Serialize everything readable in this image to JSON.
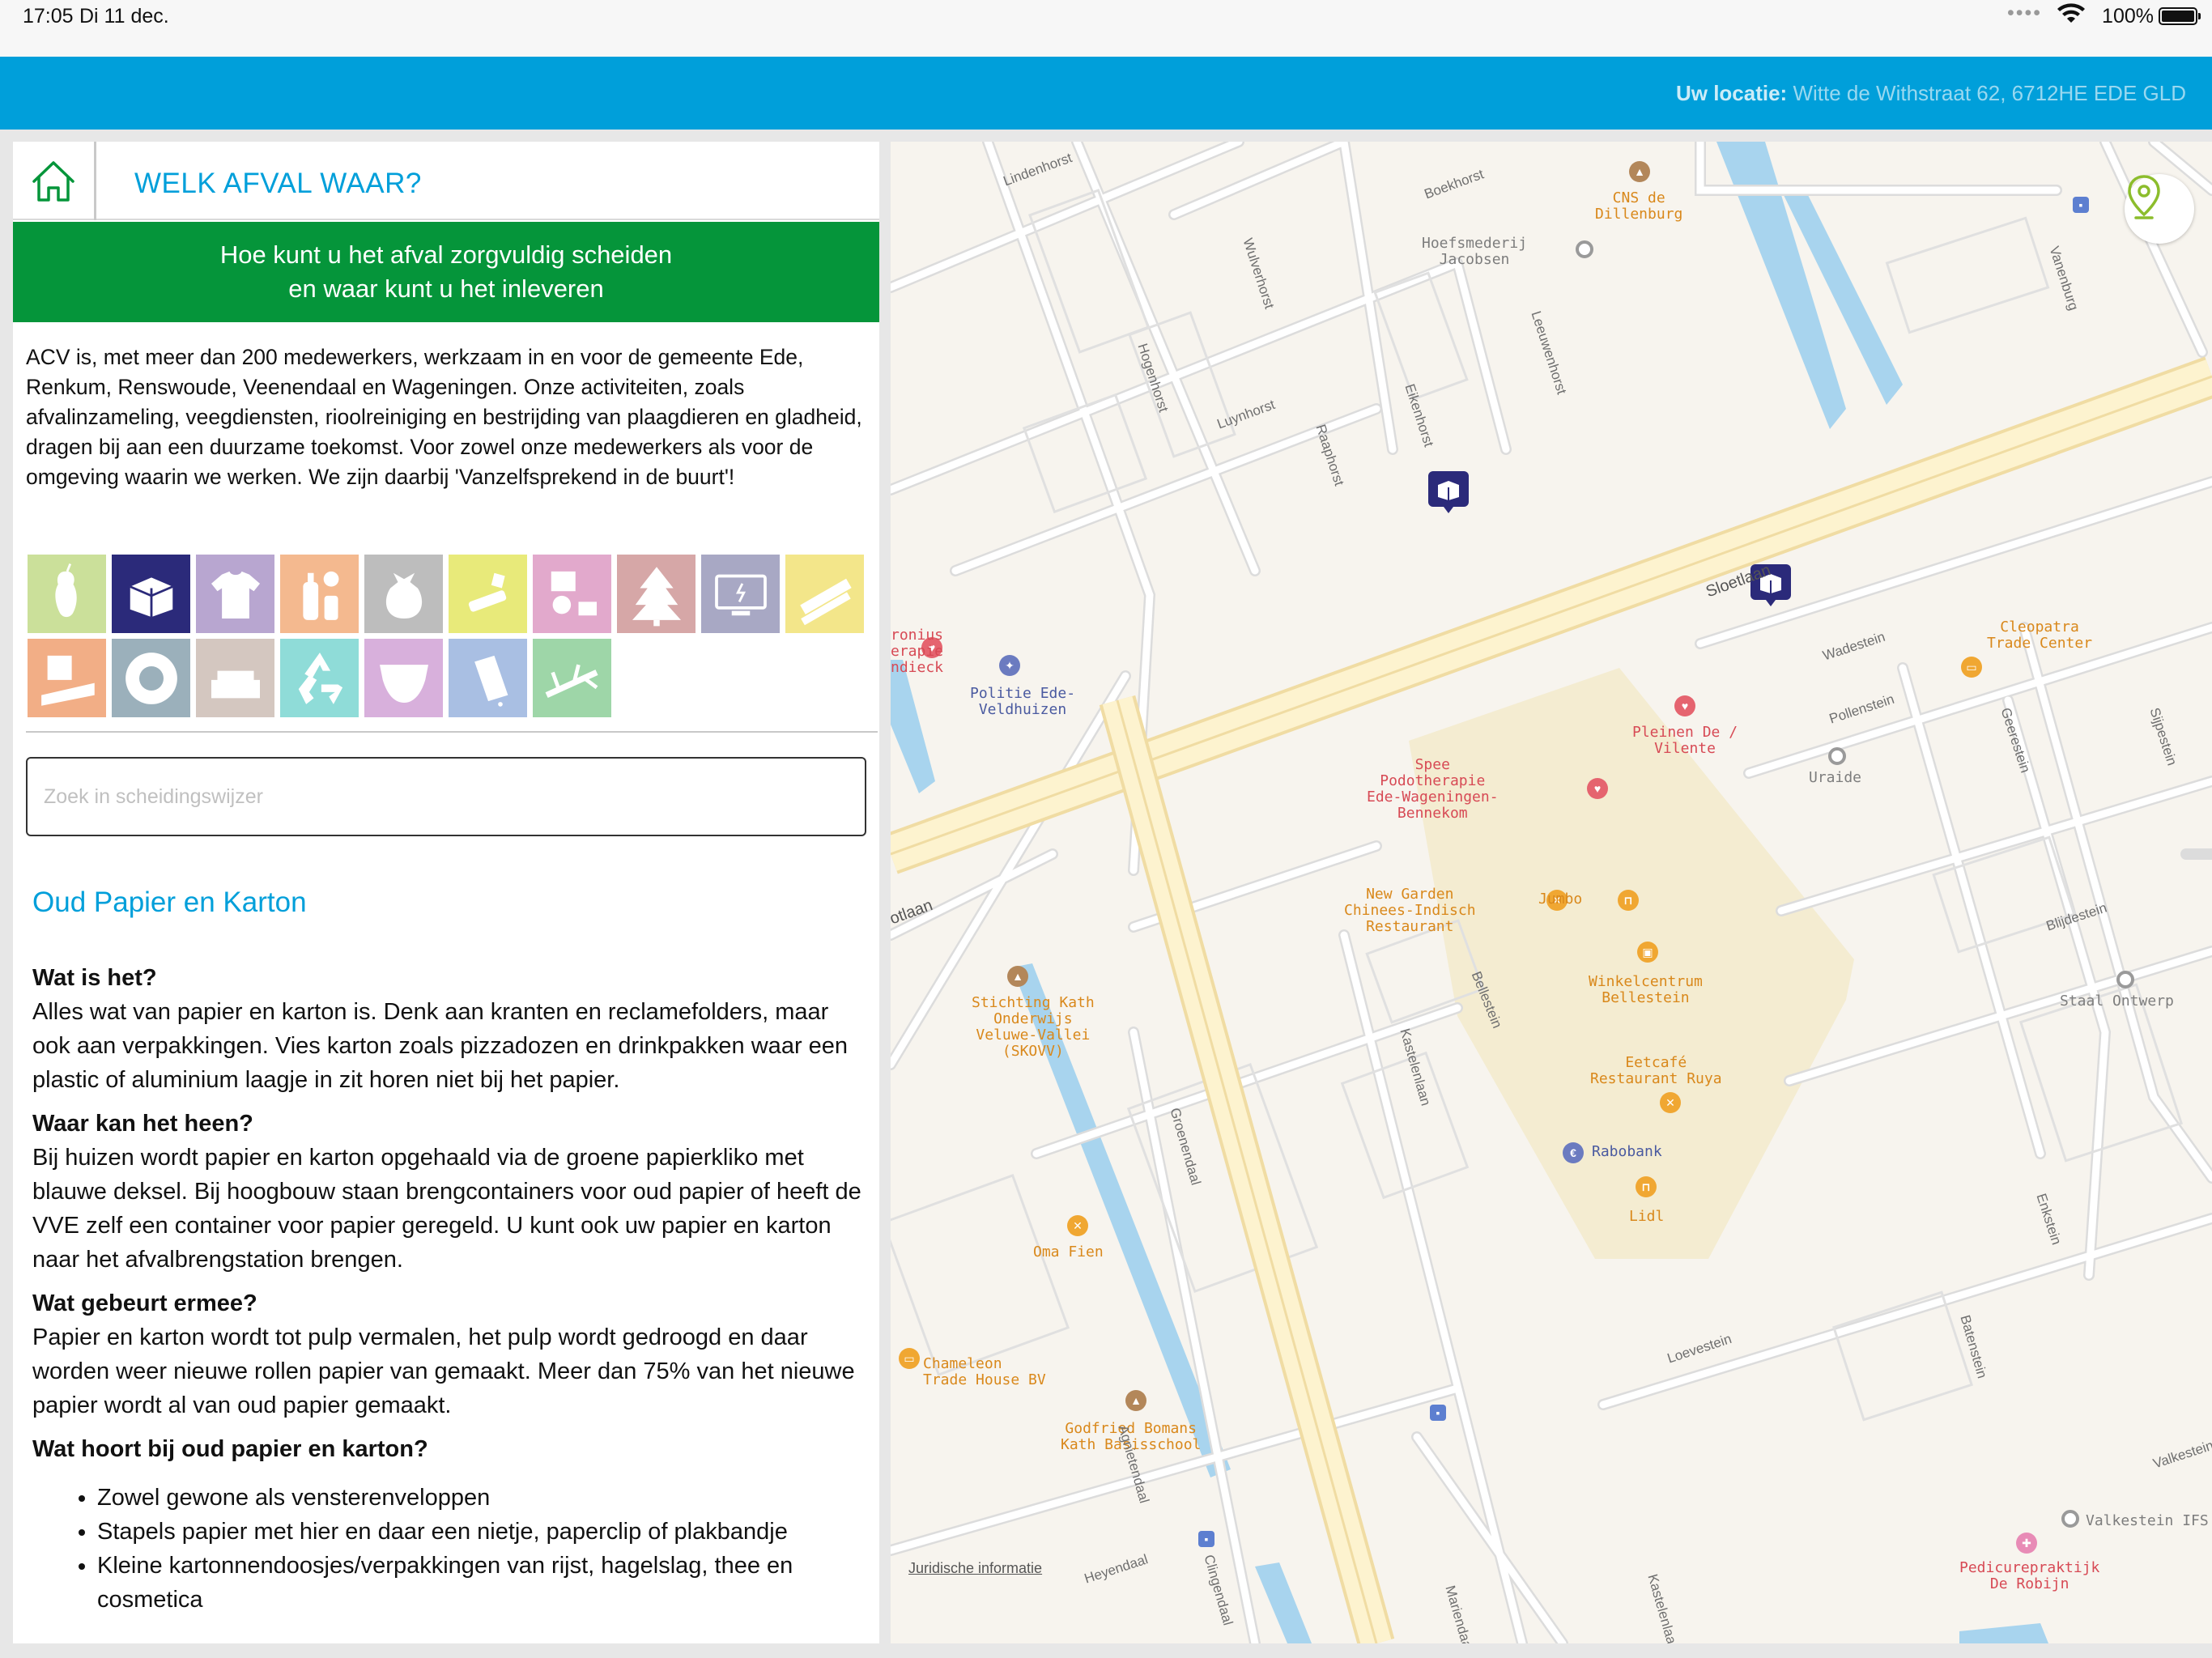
{
  "status_bar": {
    "time": "17:05",
    "date": "Di 11 dec.",
    "battery": "100%"
  },
  "top_bar": {
    "location_label": "Uw locatie:",
    "location_value": "Witte de Withstraat 62, 6712HE EDE GLD",
    "background": "#009fda"
  },
  "panel": {
    "title": "WELK AFVAL WAAR?",
    "banner_line1": "Hoe kunt u het afval zorgvuldig scheiden",
    "banner_line2": "en waar kunt u het inleveren",
    "intro": "ACV is, met meer dan 200 medewerkers, werkzaam in en voor de gemeente Ede, Renkum, Renswoude, Veenendaal en Wageningen. Onze activiteiten, zoals afvalinzameling, veegdiensten, rioolreiniging en bestrijding van plaagdieren en gladheid, dragen bij aan een duurzame toekomst. Voor zowel onze medewerkers als voor de omgeving waarin we werken. We zijn daarbij 'Vanzelfsprekend in de buurt'!",
    "search_placeholder": "Zoek in scheidingswijzer",
    "categories": [
      {
        "icon": "apple-core-icon",
        "color": "#cbe09a"
      },
      {
        "icon": "cardboard-box-icon",
        "color": "#2b2a7a",
        "selected": true
      },
      {
        "icon": "tshirt-icon",
        "color": "#b8a6d0"
      },
      {
        "icon": "bottles-icon",
        "color": "#f4b98f"
      },
      {
        "icon": "trash-bag-icon",
        "color": "#bdbdbd"
      },
      {
        "icon": "chemical-waste-icon",
        "color": "#e8ea7a"
      },
      {
        "icon": "paint-bulb-icon",
        "color": "#e2a9cc"
      },
      {
        "icon": "christmas-tree-icon",
        "color": "#d6a7a7"
      },
      {
        "icon": "monitor-icon",
        "color": "#a8a8c4"
      },
      {
        "icon": "wood-planks-icon",
        "color": "#f3e68a"
      },
      {
        "icon": "building-rubble-icon",
        "color": "#f2ae86"
      },
      {
        "icon": "tire-icon",
        "color": "#9bb0bb"
      },
      {
        "icon": "sofa-icon",
        "color": "#d4c7c0"
      },
      {
        "icon": "recycle-icon",
        "color": "#8fdcd8"
      },
      {
        "icon": "diaper-icon",
        "color": "#d8b0dc"
      },
      {
        "icon": "milk-carton-icon",
        "color": "#a9bfe3"
      },
      {
        "icon": "branches-icon",
        "color": "#9ed6a8"
      }
    ],
    "section": {
      "title": "Oud Papier en Karton",
      "q1": "Wat is het?",
      "a1": "Alles wat van papier en karton is. Denk aan kranten en reclamefolders, maar ook aan verpakkingen. Vies karton zoals pizzadozen en drinkpakken waar een plastic of aluminium laagje in zit horen niet bij het papier.",
      "q2": "Waar kan het heen?",
      "a2": "Bij huizen wordt papier en karton opgehaald via de groene papierkliko met blauwe deksel. Bij hoogbouw staan brengcontainers voor oud papier of heeft de VVE zelf een container voor papier geregeld.  U kunt ook uw papier en karton naar het afvalbrengstation brengen.",
      "q3": "Wat gebeurt ermee?",
      "a3": "Papier en karton wordt tot pulp vermalen, het pulp wordt gedroogd en daar worden weer nieuwe rollen papier van gemaakt. Meer dan 75% van het nieuwe papier wordt al van oud papier gemaakt.",
      "q4": "Wat hoort bij oud papier en karton?",
      "list": [
        "Zowel gewone als vensterenveloppen",
        "Stapels papier met hier en daar een nietje, paperclip of plakbandje",
        "Kleine kartonnendoosjes/verpakkingen van rijst, hagelslag, thee en cosmetica"
      ]
    }
  },
  "map": {
    "legal": "Juridische informatie",
    "places": {
      "cns": "CNS de\nDillenburg",
      "hoefsmederij": "Hoefsmederij\nJacobsen",
      "politie": "Politie Ede-\nVeldhuizen",
      "cleopatra": "Cleopatra\nTrade Center",
      "pleinen": "Pleinen De /\nVilente",
      "uraide": "Uraide",
      "spee": "Spee\nPodotherapie\nEde-Wageningen-\nBennekom",
      "newgarden": "New Garden\nChinees-Indisch\nRestaurant",
      "jumbo": "Jumbo",
      "winkelcentrum": "Winkelcentrum\nBellestein",
      "eetcafe": "Eetcafé\nRestaurant Ruya",
      "rabobank": "Rabobank",
      "lidl": "Lidl",
      "stichting": "Stichting Kath\nOnderwijs\nVeluwe-Vallei\n(SKOVV)",
      "omafien": "Oma Fien",
      "chameleon": "Chameleon\nTrade House BV",
      "godfried": "Godfried Bomans\nKath Basisschool",
      "staal": "Staal Ontwerp",
      "valkestein": "Valkestein IFS",
      "pedicure": "Pedicurepraktijk\nDe Robijn",
      "therapie": "ronius\nerapie\nndieck"
    },
    "streets": {
      "lindenhorst": "Lindenhorst",
      "boekhorst": "Boekhorst",
      "wulverhorst": "Wulverhorst",
      "hogenhorst": "Hogenhorst",
      "luynhorst": "Luynhorst",
      "raaphorst": "Raaphorst",
      "eikenhorst": "Eikenhorst",
      "leeuwenhorst": "Leeuwenhorst",
      "vanenburg": "Vanenburg",
      "sloetlaan": "Sloetlaan",
      "otlaan": "otlaan",
      "wadestein": "Wadestein",
      "pollenstein": "Pollenstein",
      "geerestein": "Geerestein",
      "sijpestein": "Sijpestein",
      "bellestein": "Bellestein",
      "kastelenlaan": "Kastelenlaan",
      "groenendaal": "Groenendaal",
      "blijdestein": "Blijdestein",
      "enkstein": "Enkstein",
      "batenstein": "Batenstein",
      "loevestein": "Loevestein",
      "valkestein": "Valkestein",
      "heyendaal": "Heyendaal",
      "clingendaal": "Clingendaal",
      "marlendaal": "Mariendaal",
      "agnietendaal": "Agnietendaal",
      "kastelenlaan2": "Kastelenlaan"
    }
  }
}
